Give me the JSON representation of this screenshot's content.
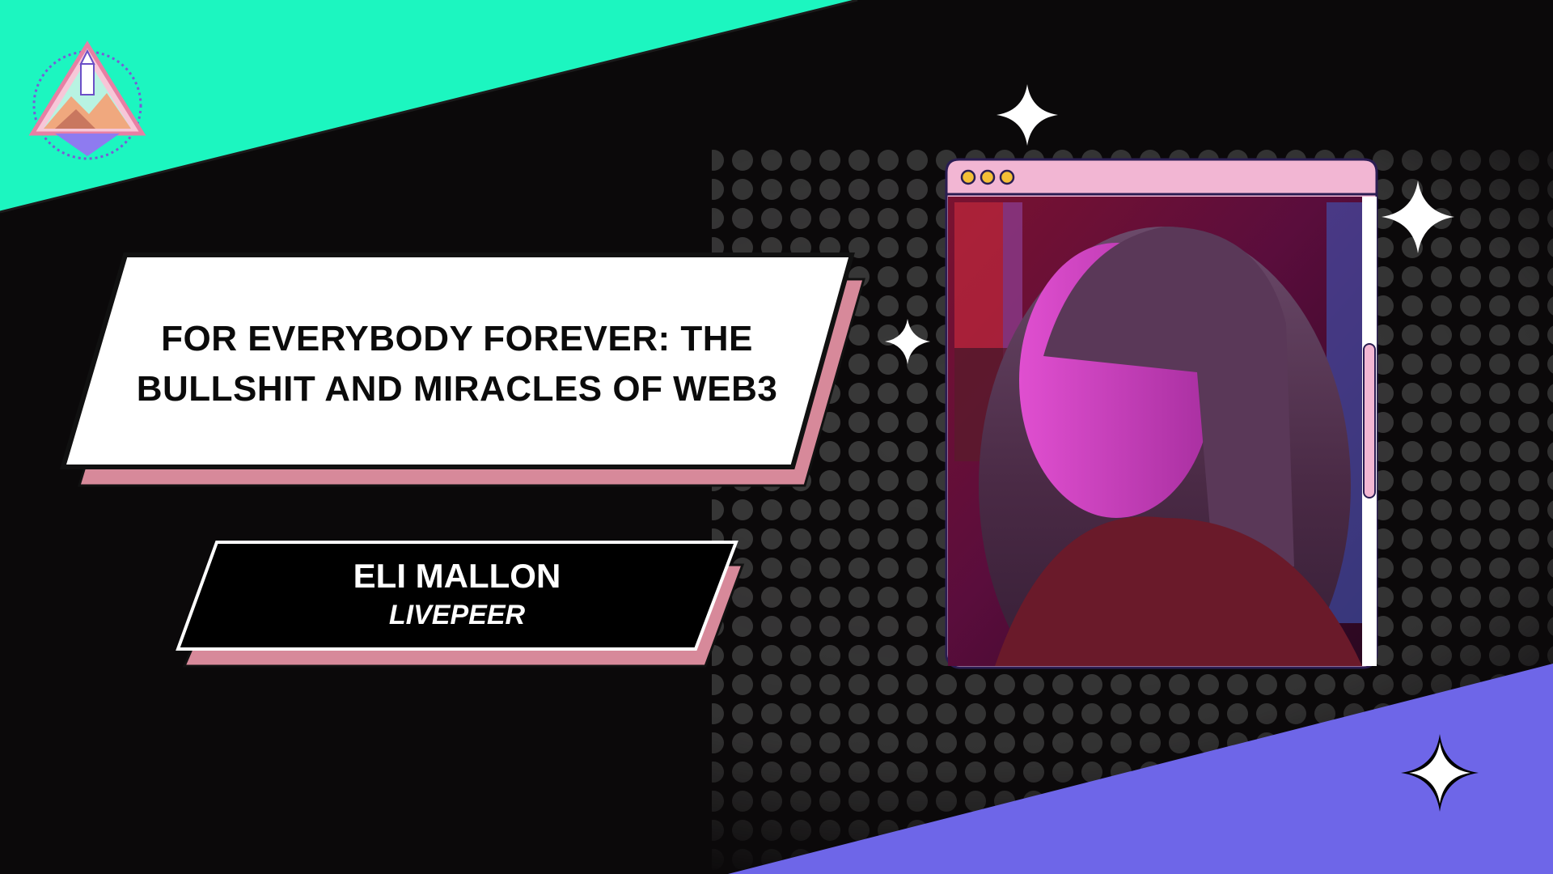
{
  "title": {
    "lines": [
      "FOR EVERYBODY FOREVER: THE",
      "BULLSHIT AND MIRACLES OF WEB3"
    ]
  },
  "speaker": {
    "name": "ELI MALLON",
    "organization": "LIVEPEER"
  },
  "icons": {
    "logo": "rocket-mountain-badge-icon",
    "sparkles": [
      "sparkle-icon",
      "sparkle-icon",
      "sparkle-icon",
      "sparkle-icon"
    ],
    "window_dots": [
      "dot-icon",
      "dot-icon",
      "dot-icon"
    ]
  },
  "colors": {
    "background": "#0b090a",
    "top_band": "#1cf6c0",
    "bottom_band": "#6e66e8",
    "panel_shadow": "#d7899a",
    "window_bar": "#f2b6d3",
    "window_dot": "#f4bf36",
    "halftone_dot": "#3c3c3c"
  }
}
